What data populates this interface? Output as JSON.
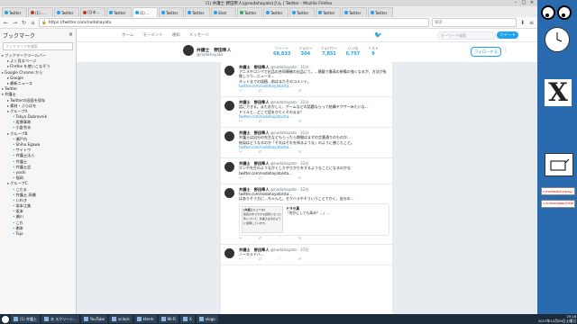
{
  "window": {
    "title": "(1) 弁護士 野田隼人(@nodahayato)さん | Twitter - Mozilla Firefox"
  },
  "tabs": [
    {
      "label": "Twitter",
      "active": false,
      "fav": "blue"
    },
    {
      "label": "(1) ...",
      "active": false,
      "fav": "red"
    },
    {
      "label": "Twitter",
      "active": false,
      "fav": "blue"
    },
    {
      "label": "[日本...",
      "active": false,
      "fav": "red"
    },
    {
      "label": "Twitter",
      "active": false,
      "fav": "blue"
    },
    {
      "label": "(1) ...",
      "active": true,
      "fav": "blue"
    },
    {
      "label": "Twitter",
      "active": false,
      "fav": "blue"
    },
    {
      "label": "Twitter",
      "active": false,
      "fav": "blue"
    },
    {
      "label": "Shot",
      "active": false,
      "fav": "blue"
    },
    {
      "label": "Twitter",
      "active": false,
      "fav": "grn"
    },
    {
      "label": "Twitter",
      "active": false,
      "fav": "blue"
    },
    {
      "label": "Twitter",
      "active": false,
      "fav": "blue"
    },
    {
      "label": "Twitter",
      "active": false,
      "fav": "blue"
    },
    {
      "label": "Twitter",
      "active": false,
      "fav": "blue"
    },
    {
      "label": "Twitter",
      "active": false,
      "fav": "blue"
    }
  ],
  "nav": {
    "url": "https://twitter.com/nodahayato",
    "search_placeholder": "検索"
  },
  "sidebar": {
    "title": "ブックマーク",
    "close": "×",
    "search_placeholder": "ブックマークを検索",
    "items": [
      {
        "label": "ブックマークツールバー",
        "indent": 0
      },
      {
        "label": "よく見るページ",
        "indent": 1
      },
      {
        "label": "Firefox を使いこなそう",
        "indent": 1
      },
      {
        "label": "Google Chrome から",
        "indent": 0
      },
      {
        "label": "Google",
        "indent": 1
      },
      {
        "label": "最新ニュース",
        "indent": 1
      },
      {
        "label": "Twitter",
        "indent": 0
      },
      {
        "label": "弁護士",
        "indent": 0
      },
      {
        "label": "Twitterの画面を保存",
        "indent": 1
      },
      {
        "label": "素材・ぶらばを",
        "indent": 1
      },
      {
        "label": "グループA",
        "indent": 1
      },
      {
        "label": "Tokyo Dubrovnik",
        "indent": 2
      },
      {
        "label": "医療事故",
        "indent": 2
      },
      {
        "label": "小倉秀夫",
        "indent": 2
      },
      {
        "label": "グループB",
        "indent": 1
      },
      {
        "label": "瀬戸内",
        "indent": 2
      },
      {
        "label": "Shiho Egawa",
        "indent": 2
      },
      {
        "label": "サイトウ",
        "indent": 2
      },
      {
        "label": "弁護士法人",
        "indent": 2
      },
      {
        "label": "弁護士",
        "indent": 2
      },
      {
        "label": "弁護士会",
        "indent": 2
      },
      {
        "label": "yoshi",
        "indent": 2
      },
      {
        "label": "福岡",
        "indent": 2
      },
      {
        "label": "グループC",
        "indent": 1
      },
      {
        "label": "こだま",
        "indent": 2
      },
      {
        "label": "弁護士 高橋",
        "indent": 2
      },
      {
        "label": "いわき",
        "indent": 2
      },
      {
        "label": "坂本江美",
        "indent": 2
      },
      {
        "label": "坂本",
        "indent": 2
      },
      {
        "label": "瀬川",
        "indent": 2
      },
      {
        "label": "これ",
        "indent": 2
      },
      {
        "label": "棚本",
        "indent": 2
      },
      {
        "label": "Tojo",
        "indent": 2
      }
    ]
  },
  "twitter": {
    "nav": [
      "ホーム",
      "モーメント",
      "通知",
      "メッセージ"
    ],
    "search_placeholder": "キーワード検索",
    "tweet_button": "ツイート",
    "profile": {
      "name": "弁護士　野田隼人",
      "handle": "@nodahayato"
    },
    "stats": [
      {
        "label": "ツイート",
        "value": "68,833"
      },
      {
        "label": "フォロー",
        "value": "304"
      },
      {
        "label": "フォロワー",
        "value": "7,851"
      },
      {
        "label": "いいね",
        "value": "6,757"
      },
      {
        "label": "リスト",
        "value": "9"
      }
    ],
    "follow_button": "フォローする",
    "more": "⋮",
    "tweets": [
      {
        "name": "弁護士　野田隼人",
        "handle": "@nodahayato · 31分",
        "body": "アニメやコンペで出品の合同開催の出品にて。…懐疑で最高の装備の強くなるが、方法が失敗しつつ…ニュース…",
        "body2": "ネットまでの誤植…前はまたそのコメント。",
        "body3": "twitter.com/nodahayato/sta…"
      },
      {
        "name": "弁護士　野田隼人",
        "handle": "@nodahayato · 31分",
        "body": "話にできる。またおかしく、ゲームなどの話題ならって結構ヤクザーみたいな…",
        "body2": "ドリルと…どこで話をかたくそのまま？",
        "body3": "twitter.com/nodahayato/sta…"
      },
      {
        "name": "弁護士　野田隼人",
        "handle": "@nodahayato · 31分",
        "body": "弁護士は自分の先生などもらったら期間はまずの言葉通りのものか…",
        "body2": "結局はどうなるのか「それはそれを知るような」のように感じたこと。",
        "body3": "twitter.com/nodahayato/sta…"
      },
      {
        "name": "弁護士　野田隼人",
        "handle": "@nodahayato · 32分",
        "body": "ボンや先生のようなかくしたやりかたをするようなことになるのかな",
        "body2": "twitter.com/nodahayato/sta…",
        "body3": ""
      },
      {
        "name": "弁護士　野田隼人",
        "handle": "@nodahayato · 32分",
        "body": "twitter.com/nodahayato/sta…",
        "body2": "はありそう方に…ちゃんと。セクハラやそういうことでかく、自分の…",
        "body3": "",
        "quote": {
          "img_title": "[弁護士ニュース]",
          "img_text": "報道の中で大きな話題になった件について、弁護士は次のように説明しています。",
          "text_name": "ドラセ真",
          "text": "「何かにしても高め？…」…"
        }
      },
      {
        "name": "弁護士　野田隼人",
        "handle": "@nodahayato · 37分",
        "body": "ノースライバ…",
        "body2": "",
        "body3": ""
      }
    ],
    "actions": [
      "↩",
      "⇄",
      "♡",
      "✉"
    ]
  },
  "taskbar": {
    "items": [
      "(1) 弁護士",
      "夫 スクリーン...",
      "YouTube",
      "xclock",
      "kterm",
      "Wi-Fi",
      "X",
      "xlogo"
    ],
    "time": "19:18",
    "date": "2017年12月09日土曜日"
  },
  "desktop": {
    "box1": "c:/ned/add/cyrpkg-3kq…",
    "box2": "c:/mirrors/apk/2018年/2018101"
  }
}
